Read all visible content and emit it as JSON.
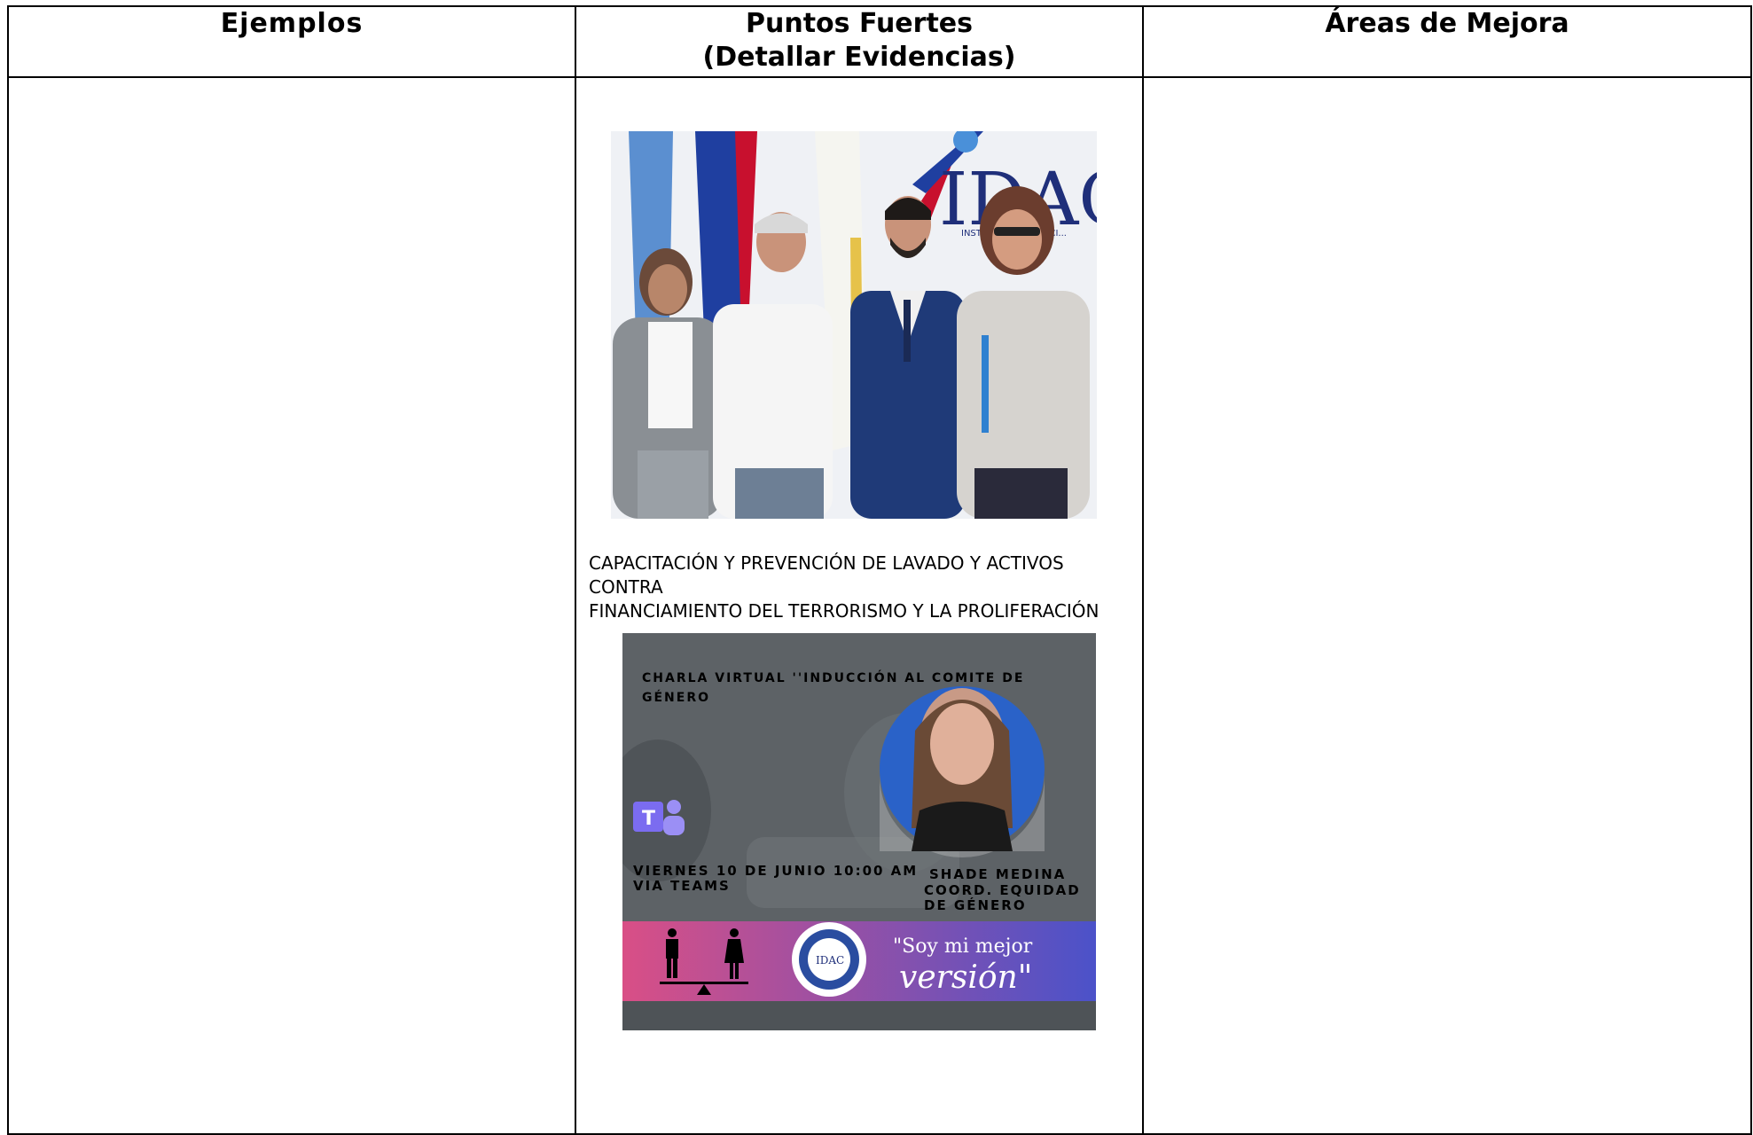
{
  "table": {
    "headers": {
      "col1": "Ejemplos",
      "col2_line1": "Puntos Fuertes",
      "col2_line2": "(Detallar Evidencias)",
      "col3": "Áreas de Mejora"
    },
    "evidence": {
      "photo_logo_text": "IDAC",
      "photo_logo_subtext": "INSTITUTO D... AVIACI...",
      "caption_line1": "CAPACITACIÓN Y PREVENCIÓN DE LAVADO Y ACTIVOS CONTRA",
      "caption_line2": "FINANCIAMIENTO DEL TERRORISMO Y LA PROLIFERACIÓN",
      "poster": {
        "title_line1": "CHARLA VIRTUAL ''INDUCCIÓN AL COMITE DE",
        "title_line2": "GÉNERO",
        "date_line1": "VIERNES 10 DE JUNIO 10:00 AM",
        "date_line2": "VIA TEAMS",
        "speaker_line1": "SHADE MEDINA",
        "speaker_line2": "COORD. EQUIDAD",
        "speaker_line3": "DE GÉNERO",
        "slogan_line1": "\"Soy mi mejor",
        "slogan_line2": "versión\"",
        "seal_text": "IDAC"
      }
    }
  },
  "colors": {
    "border": "#000000",
    "poster_bg": "#5f6468",
    "banner_left": "#d94f86",
    "banner_right": "#4b52c9",
    "teams": "#7b6cf0"
  }
}
